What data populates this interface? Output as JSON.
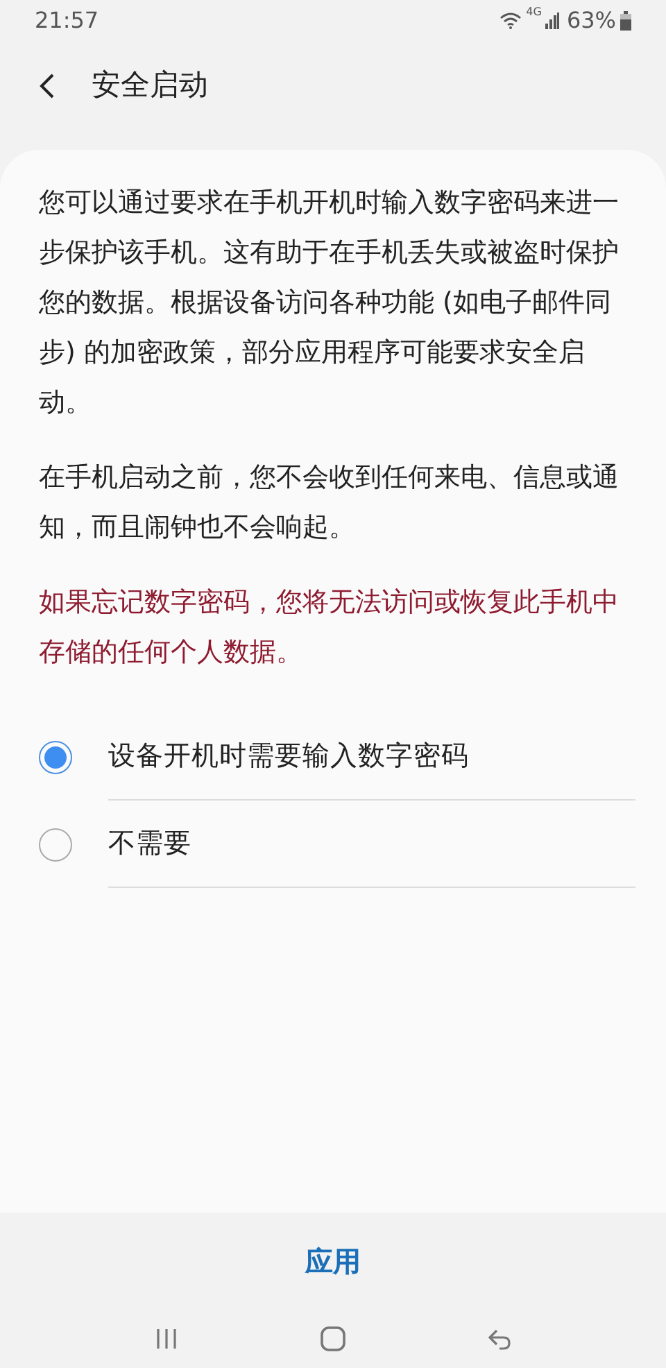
{
  "status_bar": {
    "time": "21:57",
    "network": "4G",
    "battery": "63%"
  },
  "header": {
    "title": "安全启动"
  },
  "paragraphs": [
    {
      "text": "您可以通过要求在手机开机时输入数字密码来进一步保护该手机。这有助于在手机丢失或被盗时保护您的数据。根据设备访问各种功能 (如电子邮件同步) 的加密政策，部分应用程序可能要求安全启动。",
      "kind": "normal"
    },
    {
      "text": "在手机启动之前，您不会收到任何来电、信息或通知，而且闹钟也不会响起。",
      "kind": "normal"
    },
    {
      "text": "如果忘记数字密码，您将无法访问或恢复此手机中存储的任何个人数据。",
      "kind": "warning"
    }
  ],
  "options": [
    {
      "label": "设备开机时需要输入数字密码",
      "selected": true
    },
    {
      "label": "不需要",
      "selected": false
    }
  ],
  "apply_button": "应用"
}
